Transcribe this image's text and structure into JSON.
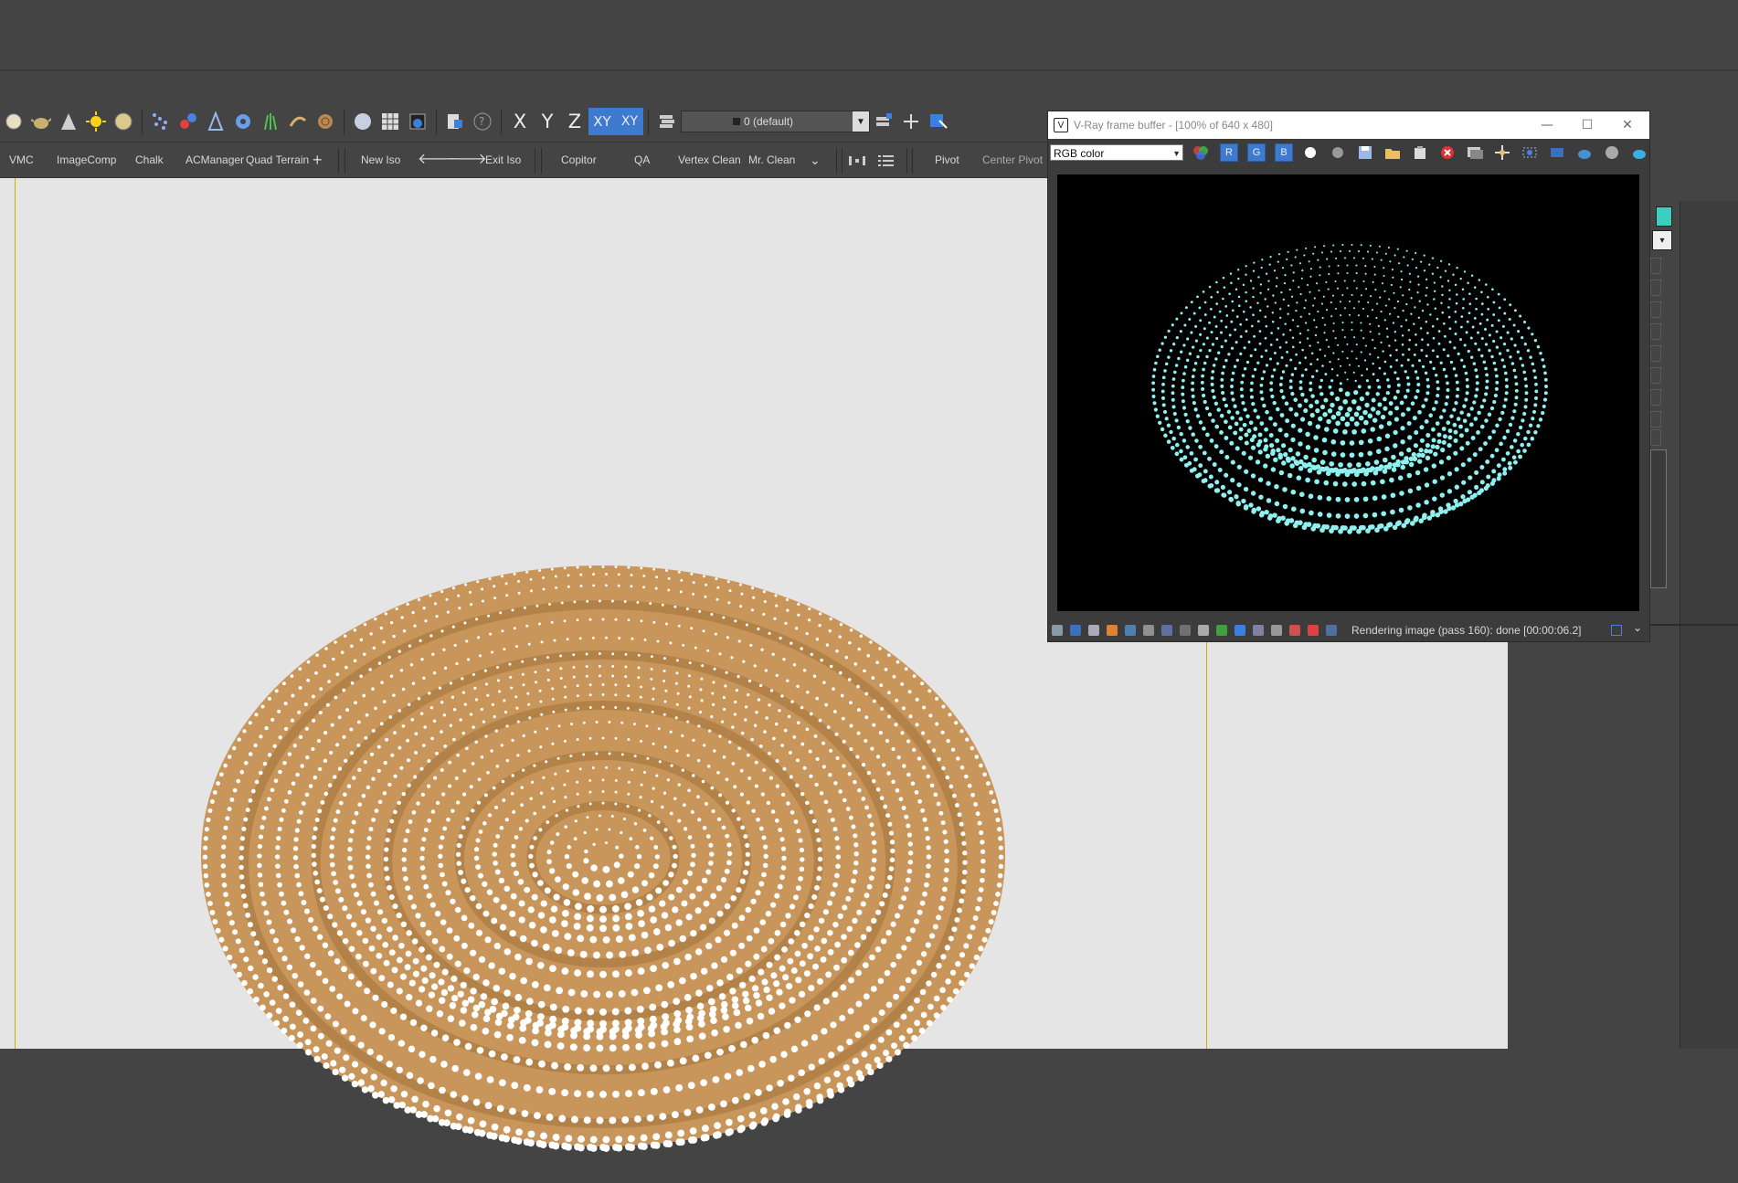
{
  "layer_dropdown": {
    "value": "0 (default)"
  },
  "axis_constraints": {
    "x": "X",
    "y": "Y",
    "z": "Z",
    "xy": "XY",
    "xy_alt": "XY"
  },
  "toolbar2": {
    "vmc": "VMC",
    "imagecomp": "ImageComp",
    "chalk": "Chalk",
    "acmanager": "ACManager",
    "quad_terrain": "Quad Terrain",
    "new_iso": "New Iso",
    "exit_iso": "Exit Iso",
    "copitor": "Copitor",
    "qa": "QA",
    "vertex_clean": "Vertex Clean",
    "mr_clean": "Mr. Clean",
    "pivot": "Pivot",
    "center_pivot": "Center Pivot"
  },
  "vfb": {
    "title": "V-Ray frame buffer - [100% of 640 x 480]",
    "channel_select": "RGB color",
    "channel_buttons": {
      "r": "R",
      "g": "G",
      "b": "B"
    },
    "status": "Rendering image (pass 160): done [00:00:06.2]"
  },
  "colors": {
    "accent": "#3d7ad0",
    "object_surface": "#c8955a",
    "dots_viewport": "#ffffff",
    "dots_render": "#8ff0f0",
    "grid_line": "#c9b200"
  },
  "icons": [
    "sphere-icon",
    "teapot-icon",
    "cone-icon",
    "light-icon",
    "shaded-sphere-icon",
    "particles-icon",
    "molecule-icon",
    "compass-icon",
    "gear-icon",
    "grass-icon",
    "hair-icon",
    "wood-icon",
    "sphere-material-icon",
    "grid-icon",
    "render-setup-icon",
    "render-frame-icon",
    "help-icon",
    "layers-icon",
    "add-icon",
    "select-icon",
    "layer-manager-icon"
  ]
}
